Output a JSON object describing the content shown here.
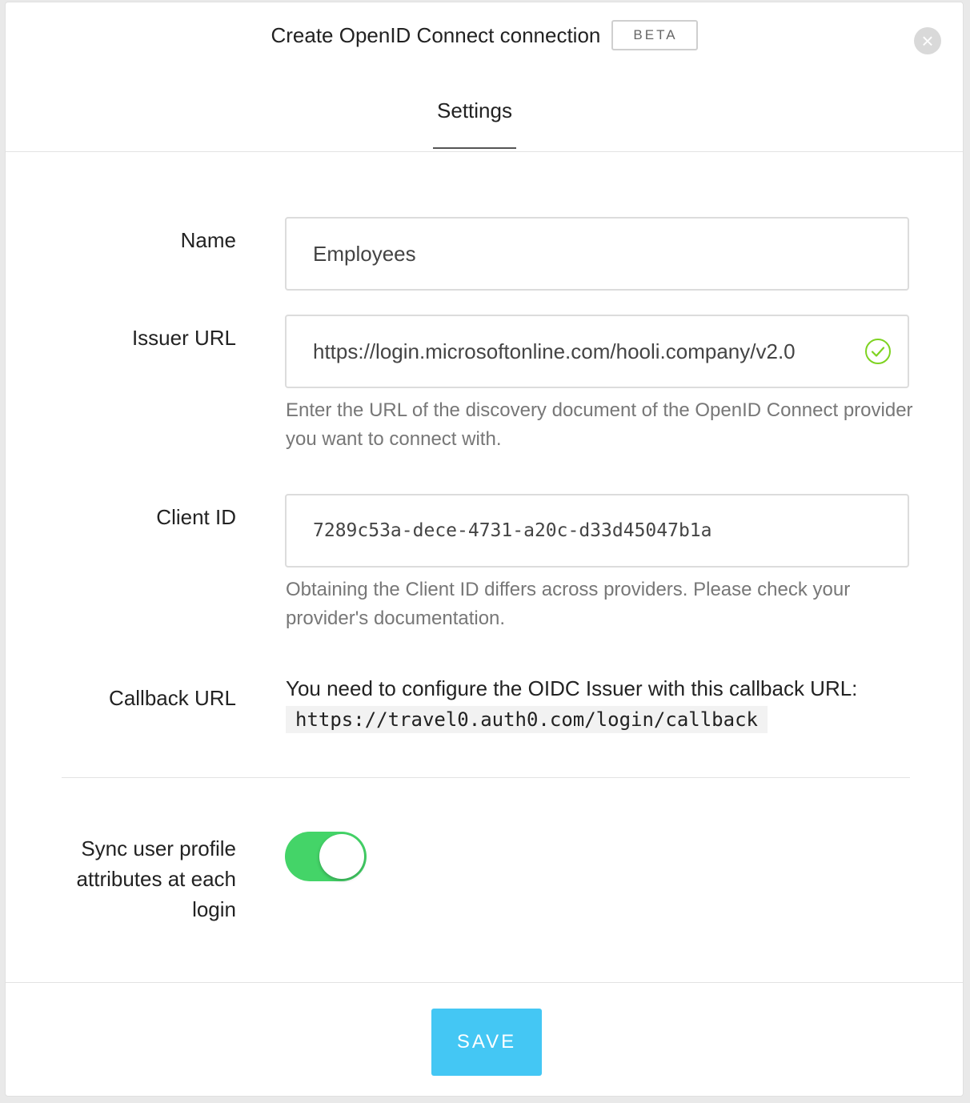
{
  "header": {
    "title": "Create OpenID Connect connection",
    "badge": "BETA",
    "close_icon": "close-icon"
  },
  "tabs": [
    {
      "label": "Settings",
      "active": true
    }
  ],
  "form": {
    "name": {
      "label": "Name",
      "value": "Employees"
    },
    "issuer_url": {
      "label": "Issuer URL",
      "value": "https://login.microsoftonline.com/hooli.company/v2.0",
      "status_icon": "check-circle-icon",
      "help": "Enter the URL of the discovery document of the OpenID Connect provider you want to connect with."
    },
    "client_id": {
      "label": "Client ID",
      "value": "7289c53a-dece-4731-a20c-d33d45047b1a",
      "help": "Obtaining the Client ID differs across providers. Please check your provider's documentation."
    },
    "callback_url": {
      "label": "Callback URL",
      "text": "You need to configure the OIDC Issuer with this callback URL:",
      "url": "https://travel0.auth0.com/login/callback"
    },
    "sync": {
      "label": "Sync user profile attributes at each login",
      "enabled": true
    }
  },
  "footer": {
    "save_label": "SAVE"
  },
  "colors": {
    "accent": "#44c7f4",
    "toggle_on": "#44d468",
    "check": "#7ed321"
  }
}
